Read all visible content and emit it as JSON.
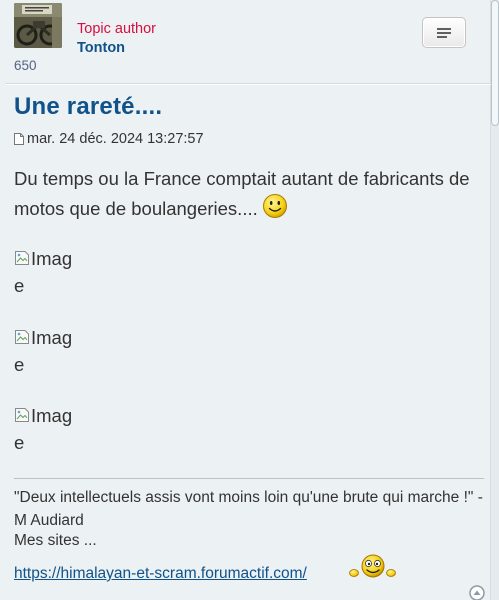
{
  "author": {
    "role": "Topic author",
    "name": "Tonton",
    "post_count": "650",
    "avatar_icon": "avatar-photo"
  },
  "post": {
    "title": "Une rareté....",
    "date": "mar. 24 déc. 2024 13:27:57",
    "text": "Du temps ou la France comptait autant de fabricants de motos que de boulangeries....",
    "images": [
      {
        "alt_line1": "Imag",
        "alt_line2": "e"
      },
      {
        "alt_line1": "Imag",
        "alt_line2": "e"
      },
      {
        "alt_line1": "Imag",
        "alt_line2": "e"
      }
    ]
  },
  "signature": {
    "quote": "\"Deux intellectuels assis vont moins loin qu'une brute qui marche !\" - M Audiard",
    "sites_label": "Mes sites ...",
    "link": "https://himalayan-et-scram.forumactif.com/"
  },
  "colors": {
    "link_blue": "#105289",
    "author_red": "#d31141",
    "text": "#333333",
    "background": "#ecf1f3"
  }
}
